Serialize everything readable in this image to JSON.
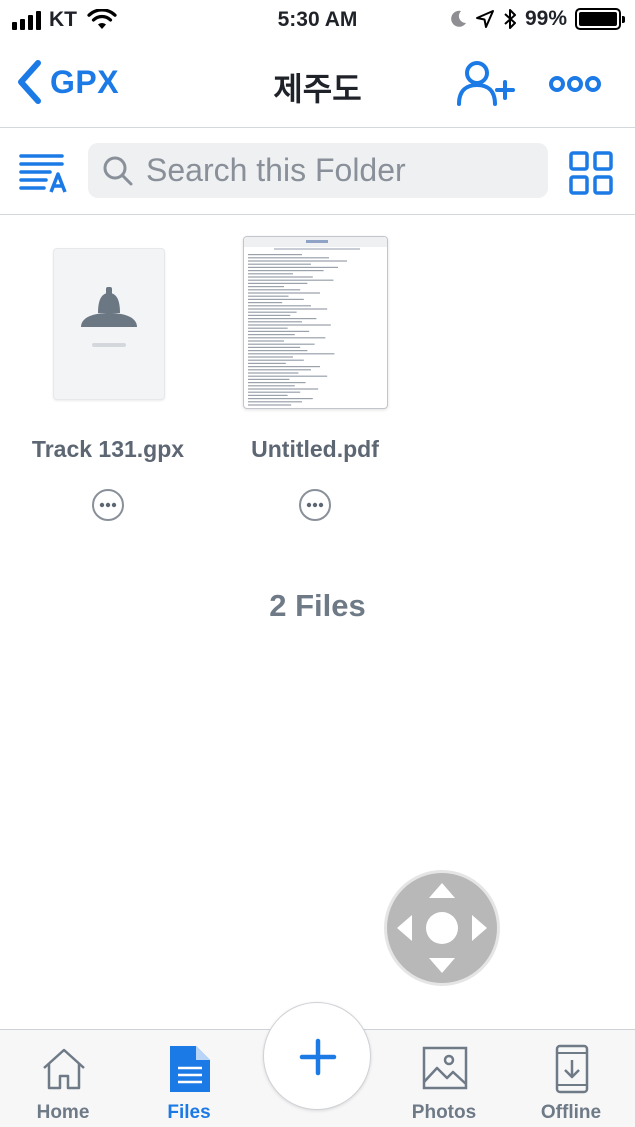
{
  "status_bar": {
    "carrier": "KT",
    "time": "5:30 AM",
    "battery_percent": "99%",
    "battery_level": 0.99,
    "icons": [
      "signal-icon",
      "wifi-icon",
      "moon-icon",
      "location-icon",
      "bluetooth-icon",
      "battery-icon"
    ]
  },
  "nav": {
    "back_label": "GPX",
    "title": "제주도",
    "right_icons": [
      "add-person-icon",
      "more-icon"
    ]
  },
  "toolbar": {
    "search_placeholder": "Search this Folder",
    "left_icon": "sort-icon",
    "right_icon": "grid-view-icon"
  },
  "files": [
    {
      "name": "Track 131.gpx",
      "thumbnail": "gpx-file-icon"
    },
    {
      "name": "Untitled.pdf",
      "thumbnail": "pdf-preview"
    }
  ],
  "files_count": "2 Files",
  "tabs": [
    {
      "label": "Home",
      "icon": "home-icon",
      "active": false
    },
    {
      "label": "Files",
      "icon": "files-icon",
      "active": true
    },
    {
      "label": "Photos",
      "icon": "photos-icon",
      "active": false
    },
    {
      "label": "Offline",
      "icon": "offline-icon",
      "active": false
    }
  ],
  "colors": {
    "accent": "#1c7ae6",
    "text_secondary": "#5d6673",
    "search_bg": "#eef0f2"
  }
}
